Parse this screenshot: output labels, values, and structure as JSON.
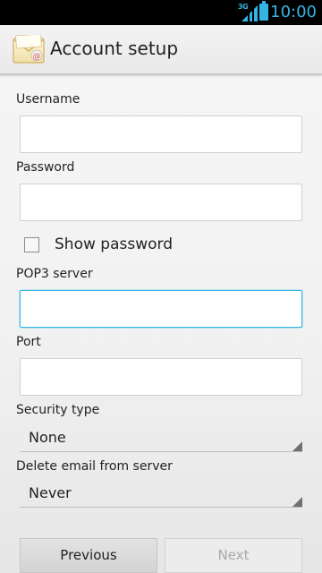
{
  "status_bar": {
    "network": "3G",
    "time": "10:00"
  },
  "action_bar": {
    "icon": "email-envelope-icon",
    "title": "Account setup"
  },
  "form": {
    "username": {
      "label": "Username",
      "value": ""
    },
    "password": {
      "label": "Password",
      "value": ""
    },
    "show_password": {
      "label": "Show password",
      "checked": false
    },
    "pop3_server": {
      "label": "POP3 server",
      "value": "",
      "focused": true
    },
    "port": {
      "label": "Port",
      "value": ""
    },
    "security_type": {
      "label": "Security type",
      "selected": "None"
    },
    "delete_email": {
      "label": "Delete email from server",
      "selected": "Never"
    }
  },
  "buttons": {
    "previous": "Previous",
    "next": "Next",
    "next_enabled": false
  },
  "colors": {
    "accent": "#33b5e5",
    "disabled_text": "#a8a8a8"
  }
}
